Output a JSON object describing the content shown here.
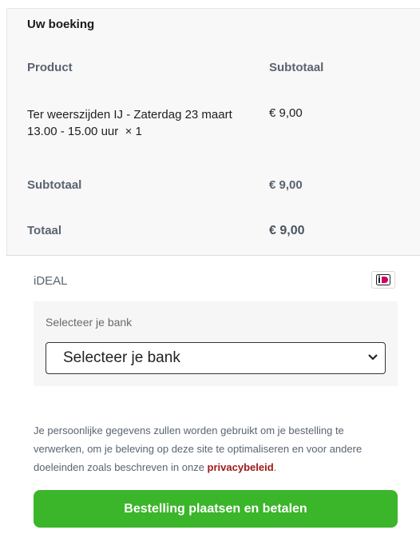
{
  "order": {
    "title": "Uw boeking",
    "col_product": "Product",
    "col_subtotal": "Subtotaal",
    "item": {
      "name": "Ter weerszijden IJ - Zaterdag 23 maart 13.00 - 15.00 uur",
      "quantity": "× 1",
      "price": "€ 9,00"
    },
    "subtotal_label": "Subtotaal",
    "subtotal_value": "€ 9,00",
    "total_label": "Totaal",
    "total_value": "€ 9,00"
  },
  "payment": {
    "method_label": "iDEAL",
    "method_icon": "ideal-logo-icon",
    "bank_label": "Selecteer je bank",
    "bank_select_value": "Selecteer je bank"
  },
  "privacy": {
    "text": "Je persoonlijke gegevens zullen worden gebruikt om je bestelling te verwerken, om je beleving op deze site te optimaliseren en voor andere doeleinden zoals beschreven in onze ",
    "link": "privacybeleid",
    "suffix": "."
  },
  "submit": {
    "label": "Bestelling plaatsen en betalen"
  },
  "colors": {
    "button": "#3bb52a",
    "link": "#a01818",
    "ideal": "#cc0066"
  }
}
